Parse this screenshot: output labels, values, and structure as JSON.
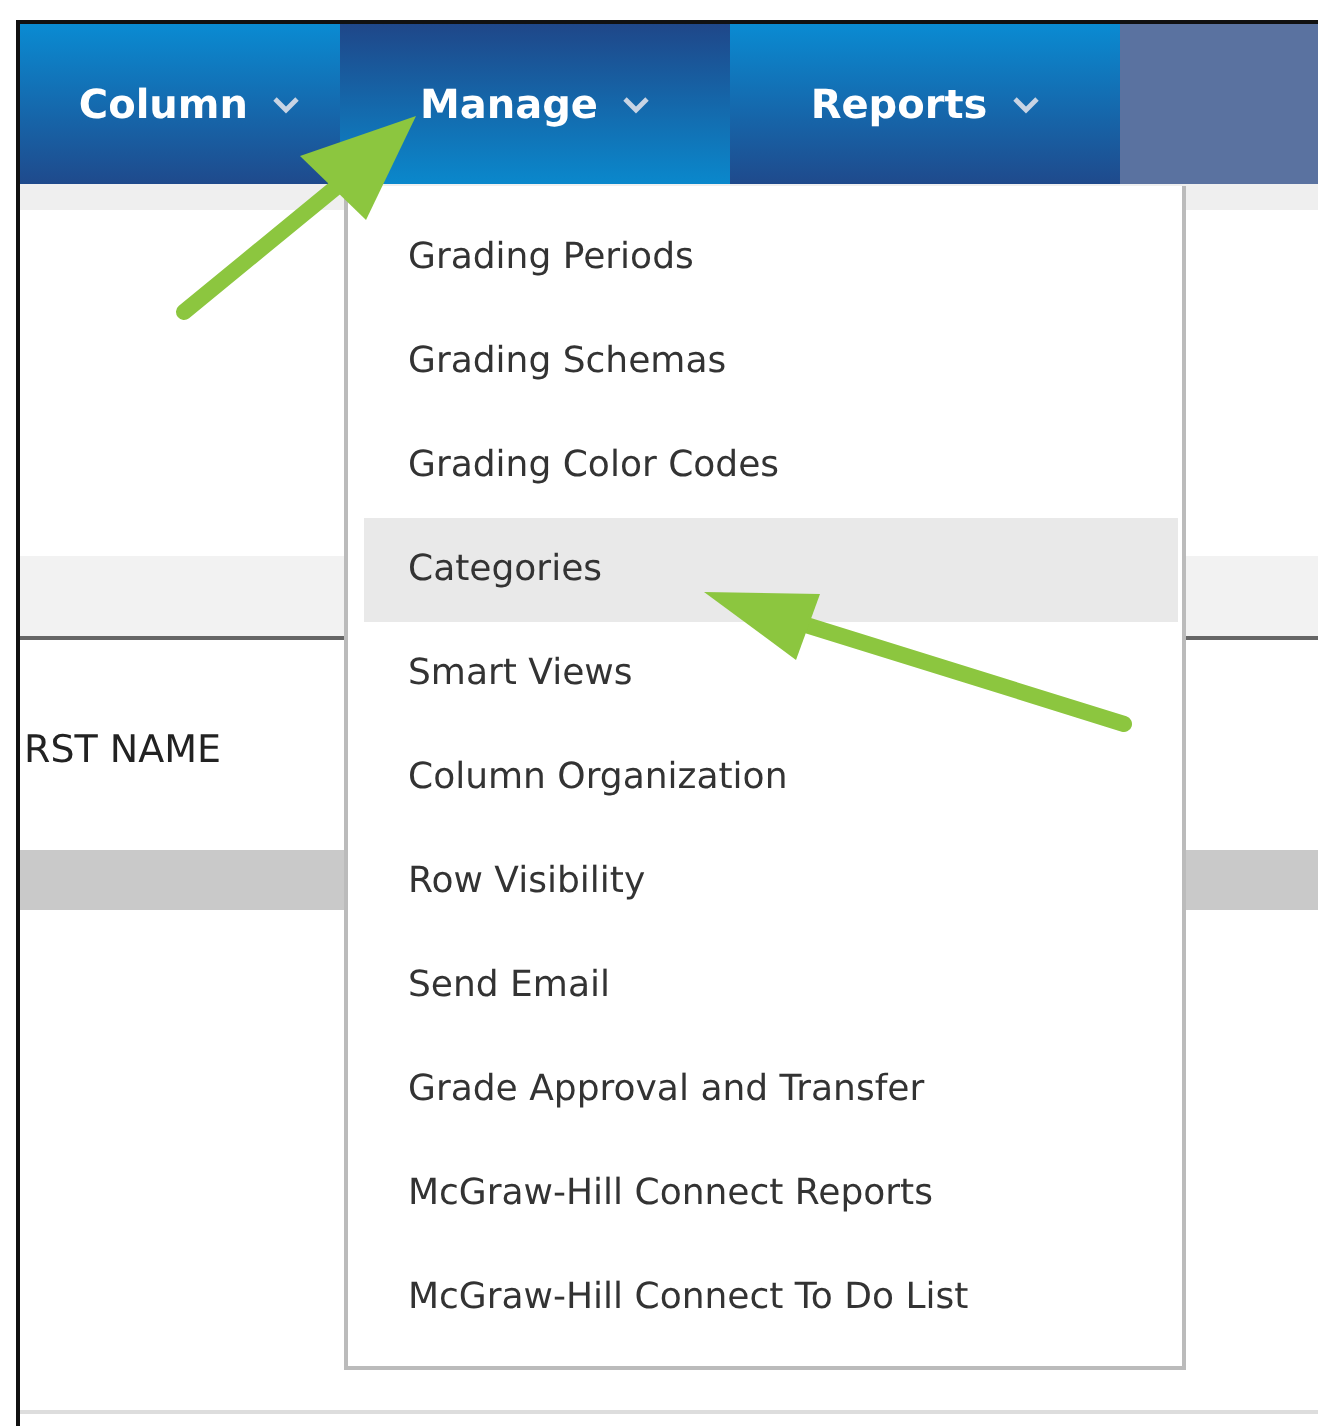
{
  "nav": [
    {
      "label": "Column",
      "selected": false
    },
    {
      "label": "Manage",
      "selected": true
    },
    {
      "label": "Reports",
      "selected": false
    }
  ],
  "table": {
    "columns": [
      {
        "label": "RST NAME"
      }
    ]
  },
  "menu": {
    "items": [
      {
        "label": "Grading Periods",
        "selected": false
      },
      {
        "label": "Grading Schemas",
        "selected": false
      },
      {
        "label": "Grading Color Codes",
        "selected": false
      },
      {
        "label": "Categories",
        "selected": true
      },
      {
        "label": "Smart Views",
        "selected": false
      },
      {
        "label": "Column Organization",
        "selected": false
      },
      {
        "label": "Row Visibility",
        "selected": false
      },
      {
        "label": "Send Email",
        "selected": false
      },
      {
        "label": "Grade Approval and Transfer",
        "selected": false
      },
      {
        "label": "McGraw-Hill Connect Reports",
        "selected": false
      },
      {
        "label": "McGraw-Hill Connect To Do List",
        "selected": false
      }
    ]
  }
}
